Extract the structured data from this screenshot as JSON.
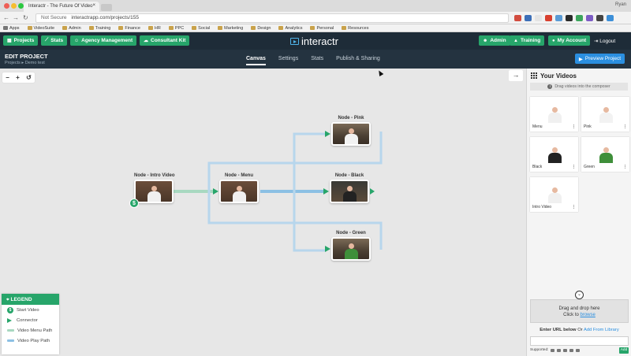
{
  "browser": {
    "tab_title": "Interactr - The Future Of Video",
    "user_label": "Ryan",
    "url_security": "Not Secure",
    "url": "interactrapp.com/projects/155",
    "bookmarks": [
      "Apps",
      "VideoSuite",
      "Admin",
      "Training",
      "Finance",
      "HR",
      "PPC",
      "Social",
      "Marketing",
      "Design",
      "Analytics",
      "Personal",
      "Resources"
    ],
    "traffic_colors": [
      "#ee5e56",
      "#f6bd2f",
      "#2bc840"
    ],
    "extension_colors": [
      "#d24c3f",
      "#3c6fb8",
      "#e4e4e4",
      "#d8402f",
      "#5b9bd5",
      "#2a2a2a",
      "#3ca55c",
      "#7c5cc4",
      "#444444",
      "#3c8fd8"
    ]
  },
  "appnav": {
    "projects": "Projects",
    "stats": "Stats",
    "agency": "Agency Management",
    "consultant": "Consultant Kit",
    "logo": "interactr",
    "admin": "Admin",
    "training": "Training",
    "account": "My Account",
    "logout": "Logout"
  },
  "subhead": {
    "title": "EDIT PROJECT",
    "breadcrumb_root": "Projects",
    "breadcrumb_current": "Demo test",
    "tabs": [
      "Canvas",
      "Settings",
      "Stats",
      "Publish & Sharing"
    ],
    "active_tab": "Canvas",
    "preview_button": "Preview Project"
  },
  "canvas": {
    "zoom_controls": [
      "−",
      "+",
      "↺"
    ],
    "nodes": [
      {
        "title": "Node - Intro Video"
      },
      {
        "title": "Node - Menu"
      },
      {
        "title": "Node - Pink"
      },
      {
        "title": "Node - Black"
      },
      {
        "title": "Node - Green"
      }
    ],
    "colors": {
      "accent": "#27a56a",
      "menu_path": "#a8d8c0",
      "play_path": "#8cc0e4"
    }
  },
  "legend": {
    "title": "LEGEND",
    "items": [
      "Start Video",
      "Connector",
      "Video Menu Path",
      "Video Play Path"
    ]
  },
  "panel": {
    "title": "Your Videos",
    "note": "Drag videos into the composer",
    "videos": [
      "Menu",
      "Pink",
      "Black",
      "Green",
      "Intro Video"
    ],
    "drop_title": "Drag and drop here",
    "drop_sub": "Click to",
    "drop_link": "browse",
    "url_label": "Enter URL below",
    "url_or": "Or",
    "url_link": "Add From Library",
    "supported": "Supported:",
    "add_button": "Add"
  }
}
